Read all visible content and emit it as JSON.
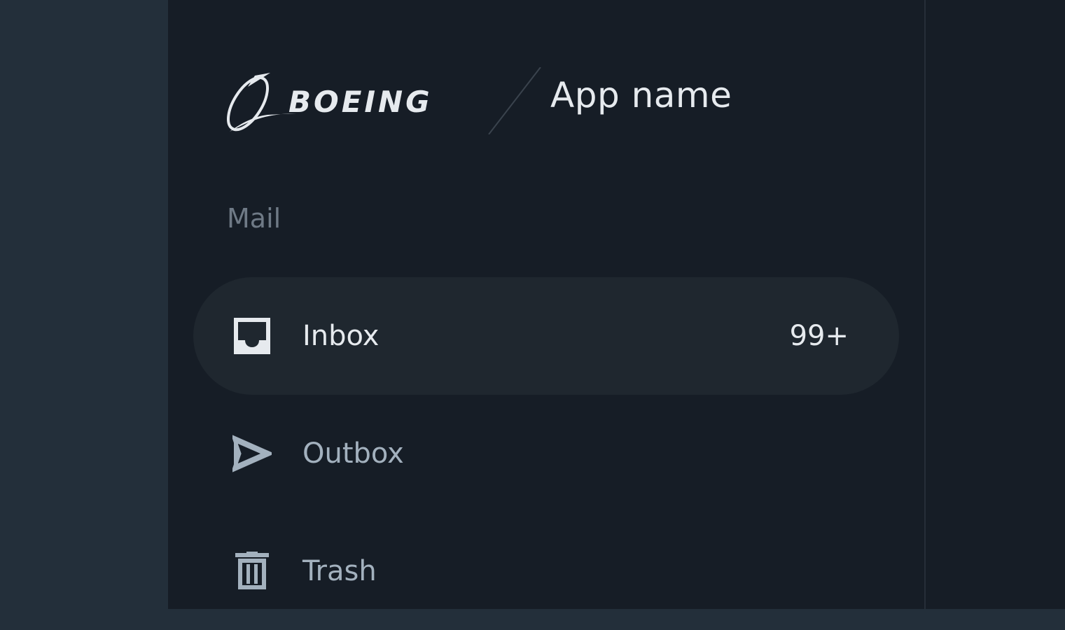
{
  "header": {
    "brand_logo": "BOEING",
    "app_name": "App name"
  },
  "sidebar": {
    "section_label": "Mail",
    "items": [
      {
        "label": "Inbox",
        "icon": "inbox-icon",
        "badge": "99+",
        "active": true
      },
      {
        "label": "Outbox",
        "icon": "send-icon",
        "active": false
      },
      {
        "label": "Trash",
        "icon": "trash-icon",
        "active": false
      }
    ]
  },
  "colors": {
    "rail_background": "#232f3a",
    "drawer_background": "#161d26",
    "active_item_background": "#1f272f",
    "primary_text": "#e6eaee",
    "muted_text": "#a3b1be",
    "section_label_text": "#6f7a86"
  }
}
